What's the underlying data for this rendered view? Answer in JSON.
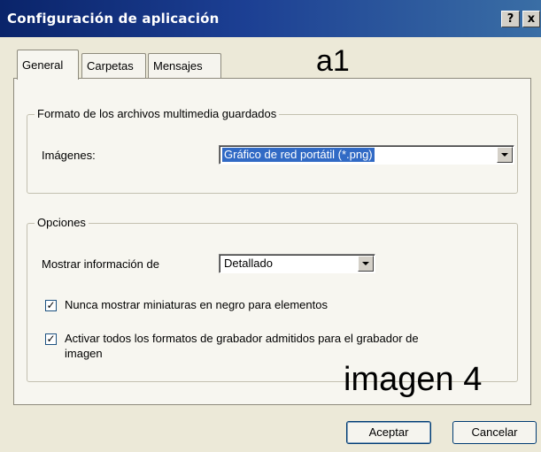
{
  "window": {
    "title": "Configuración de aplicación",
    "help_button": "?",
    "close_button": "x"
  },
  "tabs": [
    {
      "label": "General",
      "active": true
    },
    {
      "label": "Carpetas",
      "active": false
    },
    {
      "label": "Mensajes",
      "active": false
    }
  ],
  "group_media": {
    "title": "Formato de los archivos multimedia guardados",
    "images_label": "Imágenes:",
    "images_value": "Gráfico de red portátil (*.png)"
  },
  "group_options": {
    "title": "Opciones",
    "show_info_label": "Mostrar información de",
    "show_info_value": "Detallado",
    "checkbox_thumbnails": {
      "label": "Nunca mostrar miniaturas en negro para elementos",
      "checked": true
    },
    "checkbox_formats": {
      "line1": "Activar todos los formatos de grabador admitidos para el grabador de",
      "line2": "imagen",
      "checked": true
    }
  },
  "footer": {
    "ok_label": "Aceptar",
    "cancel_label": "Cancelar"
  },
  "annotations": {
    "top": "a1",
    "bottom": "imagen 4"
  }
}
